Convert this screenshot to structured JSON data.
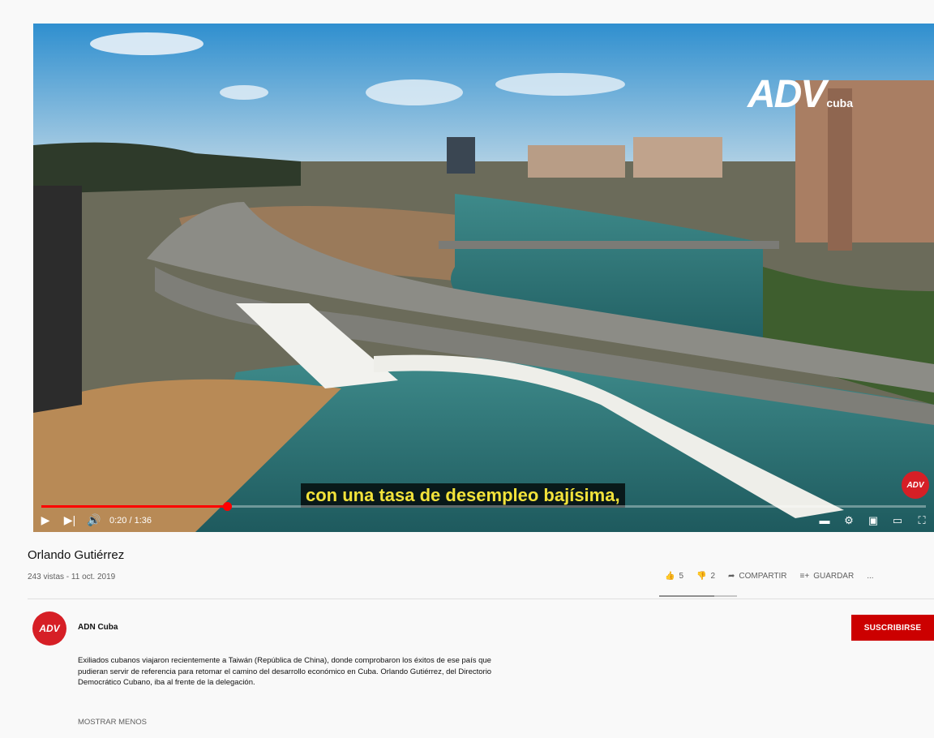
{
  "video": {
    "watermark": "ADV",
    "watermark_sub": "cuba",
    "subtitle": "con una tasa de desempleo bajísima,",
    "corner_badge": "ADV",
    "progress_fraction": 0.21,
    "time": "0:20 / 1:36",
    "icons": {
      "play": "play-icon",
      "next": "next-icon",
      "volume": "volume-icon",
      "subtitles": "subtitles-icon",
      "settings": "gear-icon",
      "miniplayer": "miniplayer-icon",
      "theater": "theater-icon",
      "fullscreen": "fullscreen-icon"
    }
  },
  "info": {
    "title": "Orlando Gutiérrez",
    "meta": "243 vistas - 11 oct. 2019",
    "likes": "5",
    "dislikes": "2",
    "share": "COMPARTIR",
    "save": "GUARDAR",
    "more": "...",
    "like_ratio": 0.71
  },
  "channel": {
    "avatar_text": "ADV",
    "name": "ADN Cuba",
    "subscribe": "SUSCRIBIRSE",
    "description": "Exiliados cubanos viajaron recientemente a Taiwán (República de China), donde comprobaron los éxitos de ese país que pudieran servir de referencia para retomar el camino del desarrollo económico en Cuba. Orlando Gutiérrez, del Directorio Democrático Cubano, iba al frente de la delegación.",
    "show_less": "MOSTRAR MENOS"
  },
  "colors": {
    "brand_red": "#cc0000",
    "progress_red": "#ff0000",
    "subtitle_yellow": "#f2e23a"
  }
}
